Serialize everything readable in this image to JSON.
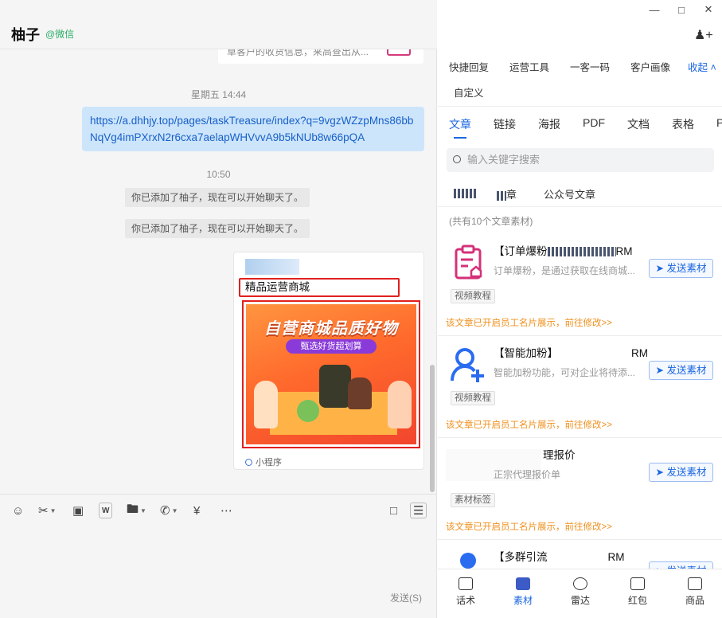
{
  "window": {
    "controls": [
      "minimize-icon",
      "maximize-icon",
      "close-icon"
    ]
  },
  "chat": {
    "title": "柚子",
    "subtitle": "@微信",
    "messages": {
      "partial_card_text": "草客户的收货信息，来高查出从...",
      "date_time": "星期五 14:44",
      "link": "https://a.dhhjy.top/pages/taskTreasure/index?q=9vgzWZzpMns86bbNqVg4imPXrxN2r6cxa7aelapWHVvvA9b5kNUb8w66pQA",
      "time2": "10:50",
      "system_1": "你已添加了柚子，现在可以开始聊天了。",
      "system_2": "你已添加了柚子，现在可以开始聊天了。",
      "miniprogram": {
        "title": "精品运营商城",
        "image_headline": "自营商城品质好物",
        "image_tag": "甄选好货超划算",
        "footer": "小程序"
      }
    },
    "toolbar": [
      "emoji-icon",
      "scissors-icon",
      "image-icon",
      "word-icon",
      "folder-icon",
      "phone-icon",
      "yen-icon",
      "more-icon",
      "history-icon",
      "sidebar-toggle-icon"
    ],
    "send_label": "发送(S)"
  },
  "panel": {
    "top_tabs": [
      "快捷回复",
      "运营工具",
      "一客一码",
      "客户画像",
      "自定义"
    ],
    "collapse_label": "收起",
    "content_tabs": [
      "文章",
      "链接",
      "海报",
      "PDF",
      "文档",
      "表格",
      "P"
    ],
    "active_content_tab": "文章",
    "search_placeholder": "输入关键字搜索",
    "subtabs": [
      "全部",
      "文章",
      "公众号文章"
    ],
    "count_text": "(共有10个文章素材)",
    "items": [
      {
        "title": "【订单爆粉",
        "title_tail": "RM",
        "desc": "订单爆粉，是通过获取在线商城...",
        "chip": "视频教程",
        "send": "发送素材",
        "warn": "该文章已开启员工名片展示，前往修改>>"
      },
      {
        "title": "【智能加粉】",
        "title_tail": "RM",
        "desc": "智能加粉功能，可对企业将待添...",
        "chip": "视频教程",
        "send": "发送素材",
        "warn": "该文章已开启员工名片展示，前往修改>>"
      },
      {
        "title": "理报价",
        "title_tail": "",
        "desc": "正宗代理报价单",
        "chip": "素材标签",
        "send": "发送素材",
        "warn": "该文章已开启员工名片展示，前往修改>>"
      },
      {
        "title": "【多群引流",
        "title_tail": "RM",
        "desc": "",
        "chip": "",
        "send": "发送素材",
        "warn": ""
      }
    ],
    "bottom_nav": [
      "话术",
      "素材",
      "雷达",
      "红包",
      "商品"
    ],
    "active_nav": "素材"
  }
}
